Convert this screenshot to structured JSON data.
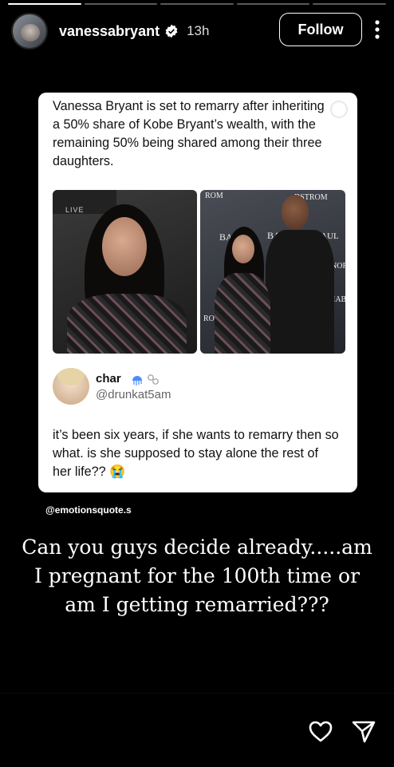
{
  "story": {
    "username": "vanessabryant",
    "time": "13h",
    "follow_label": "Follow",
    "progress_segments": 5,
    "progress_completed": 1
  },
  "post": {
    "headline": "Vanessa Bryant is set to remarry after inheriting a 50% share of Kobe Bryant’s wealth, with the remaining 50% being shared among their three daughters.",
    "left_photo_sign": "LIVE",
    "right_photo_signs": [
      "ROM",
      "DSTROM",
      "BABY",
      "BABY",
      "PAUL",
      "NOR",
      "IAB",
      "ROM"
    ],
    "reply": {
      "name": "char",
      "handle": "@drunkat5am",
      "text": "it’s been six years, if she wants to remarry then so what. is she supposed to stay alone the rest of her life?? 😭"
    }
  },
  "credit": "@emotionsquote.s",
  "caption": "Can you guys decide already.....am I pregnant for the 100th time or am I getting remarried???",
  "icons": [
    "verified-icon",
    "more-icon",
    "heart-icon",
    "send-icon"
  ]
}
